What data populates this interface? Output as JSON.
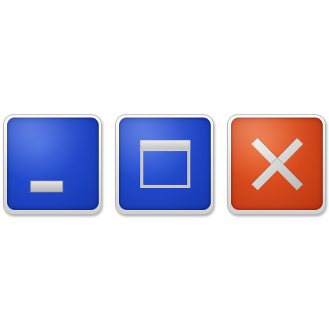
{
  "window_controls": {
    "minimize": {
      "icon": "minimize-icon",
      "face_color": "#2148c9",
      "glyph_color": "#c8c8c8"
    },
    "maximize": {
      "icon": "maximize-icon",
      "face_color": "#2148c9",
      "glyph_color": "#c8c8c8"
    },
    "close": {
      "icon": "close-icon",
      "face_color": "#d74a1c",
      "glyph_color": "#c8c8c8"
    }
  }
}
